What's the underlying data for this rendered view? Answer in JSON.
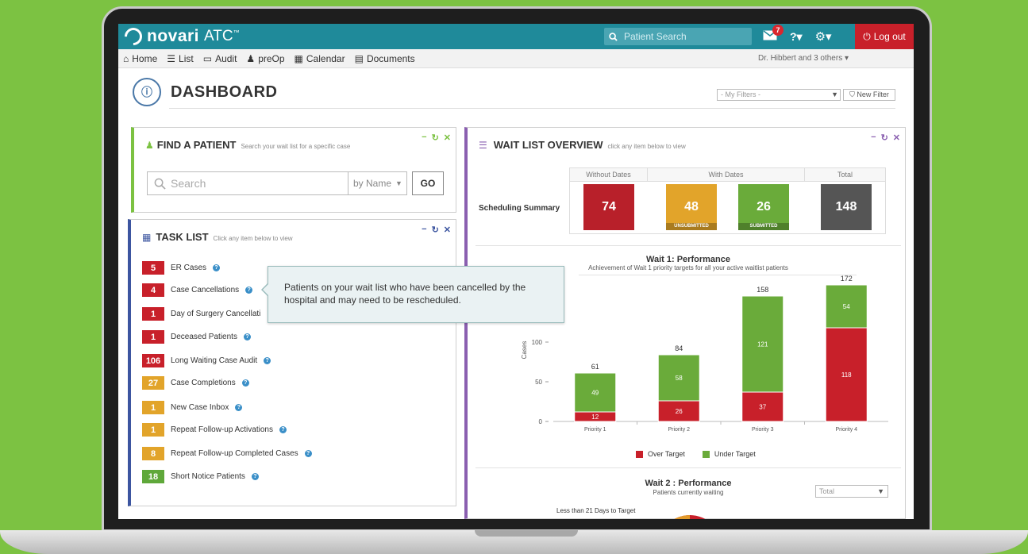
{
  "app": {
    "logo_name": "novari",
    "logo_product": "ATC",
    "logo_tm": "™",
    "search_placeholder": "Patient Search",
    "mail_count": "7",
    "logout_label": "Log out",
    "brand_color": "#1f8a9a"
  },
  "nav": {
    "items": [
      {
        "label": "Home",
        "icon": "home-icon"
      },
      {
        "label": "List",
        "icon": "list-icon"
      },
      {
        "label": "Audit",
        "icon": "folder-icon"
      },
      {
        "label": "preOp",
        "icon": "users-icon"
      },
      {
        "label": "Calendar",
        "icon": "calendar-icon"
      },
      {
        "label": "Documents",
        "icon": "document-icon"
      }
    ],
    "user": "Dr. Hibbert and 3 others ▾"
  },
  "page": {
    "title": "DASHBOARD",
    "filter_placeholder": "- My Filters -",
    "new_filter_label": "New Filter"
  },
  "find_patient": {
    "title": "FIND A PATIENT",
    "subtitle": "Search your wait list for a specific case",
    "search_placeholder": "Search",
    "by_label": "by Name",
    "go_label": "GO"
  },
  "task_list": {
    "title": "TASK LIST",
    "subtitle": "Click any item below to view",
    "items": [
      {
        "count": "5",
        "label": "ER Cases",
        "color": "#c8202a"
      },
      {
        "count": "4",
        "label": "Case Cancellations",
        "color": "#c8202a"
      },
      {
        "count": "1",
        "label": "Day of Surgery Cancellati",
        "color": "#c8202a"
      },
      {
        "count": "1",
        "label": "Deceased Patients",
        "color": "#c8202a"
      },
      {
        "count": "106",
        "label": "Long Waiting Case Audit",
        "color": "#c8202a"
      },
      {
        "count": "27",
        "label": "Case Completions",
        "color": "#e2a42a"
      },
      {
        "count": "1",
        "label": "New Case Inbox",
        "color": "#e2a42a"
      },
      {
        "count": "1",
        "label": "Repeat Follow-up Activations",
        "color": "#e2a42a"
      },
      {
        "count": "8",
        "label": "Repeat Follow-up Completed Cases",
        "color": "#e2a42a"
      },
      {
        "count": "18",
        "label": "Short Notice Patients",
        "color": "#5fa83a"
      }
    ],
    "tooltip": "Patients on your wait list who have been cancelled by the hospital and may need to be rescheduled."
  },
  "wait_list": {
    "title": "WAIT LIST OVERVIEW",
    "subtitle": "click any item below to view",
    "scheduling_label": "Scheduling Summary",
    "headers": [
      "Without Dates",
      "With Dates",
      "Total"
    ],
    "boxes": [
      {
        "value": "74",
        "strip": "",
        "color": "#b8202a"
      },
      {
        "value": "48",
        "strip": "UNSUBMITTED",
        "color": "#e2a42a"
      },
      {
        "value": "26",
        "strip": "SUBMITTED",
        "color": "#6aab3a"
      },
      {
        "value": "148",
        "strip": "",
        "color": "#555555"
      }
    ],
    "chart2": {
      "title": "Wait 2 : Performance",
      "subtitle": "Patients currently waiting",
      "select_value": "Total",
      "note": "Less than 21 Days to Target"
    }
  },
  "chart_data": {
    "type": "bar",
    "stacked": true,
    "title": "Wait 1: Performance",
    "subtitle": "Achievement of Wait 1 priority targets for all your active waitlist patients",
    "ylabel": "Cases",
    "xlabel": "",
    "categories": [
      "Priority 1",
      "Priority 2",
      "Priority 3",
      "Priority 4"
    ],
    "series": [
      {
        "name": "Over Target",
        "values": [
          12,
          26,
          37,
          118
        ],
        "color": "#c8202a"
      },
      {
        "name": "Under Target",
        "values": [
          49,
          58,
          121,
          54
        ],
        "color": "#6aab3a"
      }
    ],
    "totals": [
      61,
      84,
      158,
      172
    ],
    "yticks": [
      0,
      50,
      100
    ],
    "ylim": [
      0,
      180
    ],
    "legend": "bottom"
  }
}
